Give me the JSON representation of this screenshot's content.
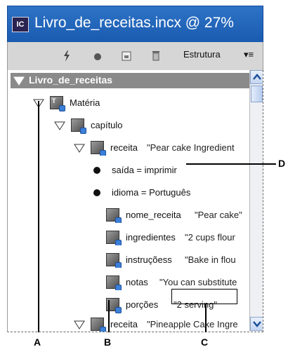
{
  "window": {
    "title": "Livro_de_receitas.incx @ 27%",
    "app_icon_text": "IC"
  },
  "toolbar": {
    "panel_tab_label": "Estrutura",
    "menu_glyph": "▾≡"
  },
  "tree": {
    "root_label": "Livro_de_receitas",
    "rows": [
      {
        "label": "Matéria",
        "value": ""
      },
      {
        "label": "capítulo",
        "value": ""
      },
      {
        "label": "receita",
        "value": "\"Pear cake Ingredient"
      },
      {
        "label": "saída = imprimir",
        "value": ""
      },
      {
        "label": "idioma = Português",
        "value": ""
      },
      {
        "label": "nome_receita",
        "value": "\"Pear cake\""
      },
      {
        "label": "ingredientes",
        "value": "\"2 cups flour"
      },
      {
        "label": "instruçõess",
        "value": "\"Bake in flou"
      },
      {
        "label": "notas",
        "value": "\"You can substitute"
      },
      {
        "label": "porções",
        "value": "\"2 serving\""
      },
      {
        "label": "receita",
        "value": "\"Pineapple Cake Ingre"
      }
    ]
  },
  "callouts": {
    "a": "A",
    "b": "B",
    "c": "C",
    "d": "D"
  }
}
